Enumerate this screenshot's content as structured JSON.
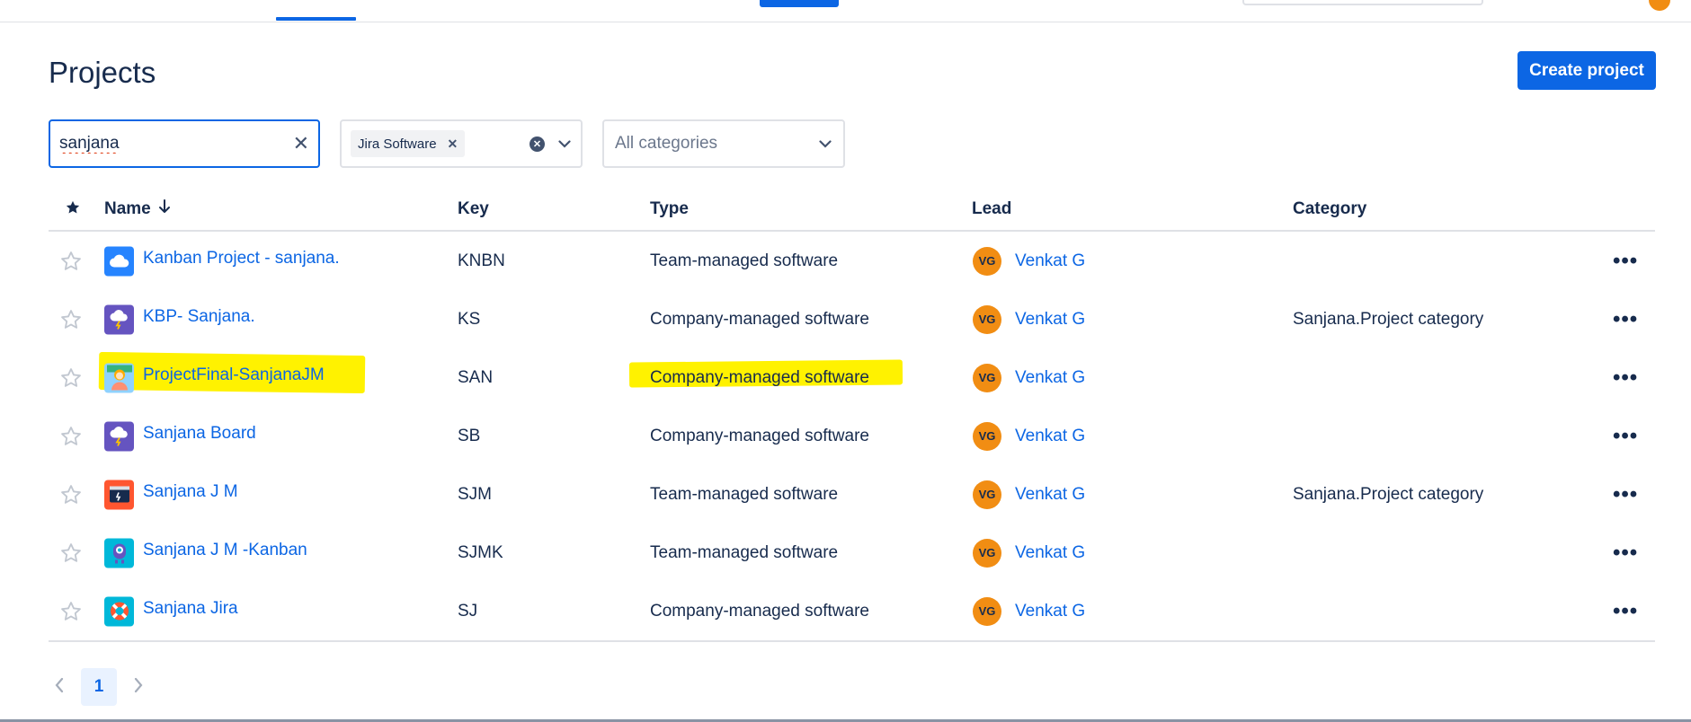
{
  "page": {
    "title": "Projects",
    "create_button": "Create project"
  },
  "filters": {
    "search_value": "sanjana",
    "product_chip": "Jira Software",
    "category_placeholder": "All categories"
  },
  "table": {
    "headers": {
      "name": "Name",
      "key": "Key",
      "type": "Type",
      "lead": "Lead",
      "category": "Category"
    },
    "rows": [
      {
        "name": "Kanban Project - sanjana.",
        "key": "KNBN",
        "type": "Team-managed software",
        "lead_initials": "VG",
        "lead": "Venkat G",
        "category": "",
        "icon": "cloud-icon",
        "icon_bg": "#2684ff"
      },
      {
        "name": "KBP- Sanjana.",
        "key": "KS",
        "type": "Company-managed software",
        "lead_initials": "VG",
        "lead": "Venkat G",
        "category": "Sanjana.Project category",
        "icon": "storm-cloud-icon",
        "icon_bg": "#6554c0"
      },
      {
        "name": "ProjectFinal-SanjanaJM",
        "key": "SAN",
        "type": "Company-managed software",
        "lead_initials": "VG",
        "lead": "Venkat G",
        "category": "",
        "icon": "person-icon",
        "icon_bg": "#8fd2ff",
        "highlighted": true
      },
      {
        "name": "Sanjana Board",
        "key": "SB",
        "type": "Company-managed software",
        "lead_initials": "VG",
        "lead": "Venkat G",
        "category": "",
        "icon": "storm-cloud-icon",
        "icon_bg": "#6554c0"
      },
      {
        "name": "Sanjana J M",
        "key": "SJM",
        "type": "Team-managed software",
        "lead_initials": "VG",
        "lead": "Venkat G",
        "category": "Sanjana.Project category",
        "icon": "terminal-icon",
        "icon_bg": "#ff5630"
      },
      {
        "name": "Sanjana J M -Kanban",
        "key": "SJMK",
        "type": "Team-managed software",
        "lead_initials": "VG",
        "lead": "Venkat G",
        "category": "",
        "icon": "robot-icon",
        "icon_bg": "#00b8d9"
      },
      {
        "name": "Sanjana Jira",
        "key": "SJ",
        "type": "Company-managed software",
        "lead_initials": "VG",
        "lead": "Venkat G",
        "category": "",
        "icon": "lifebuoy-icon",
        "icon_bg": "#00b8d9"
      }
    ]
  },
  "pagination": {
    "current_page": "1"
  },
  "colors": {
    "accent": "#0c66e4",
    "avatar": "#f18d13",
    "highlight": "#fff200"
  }
}
